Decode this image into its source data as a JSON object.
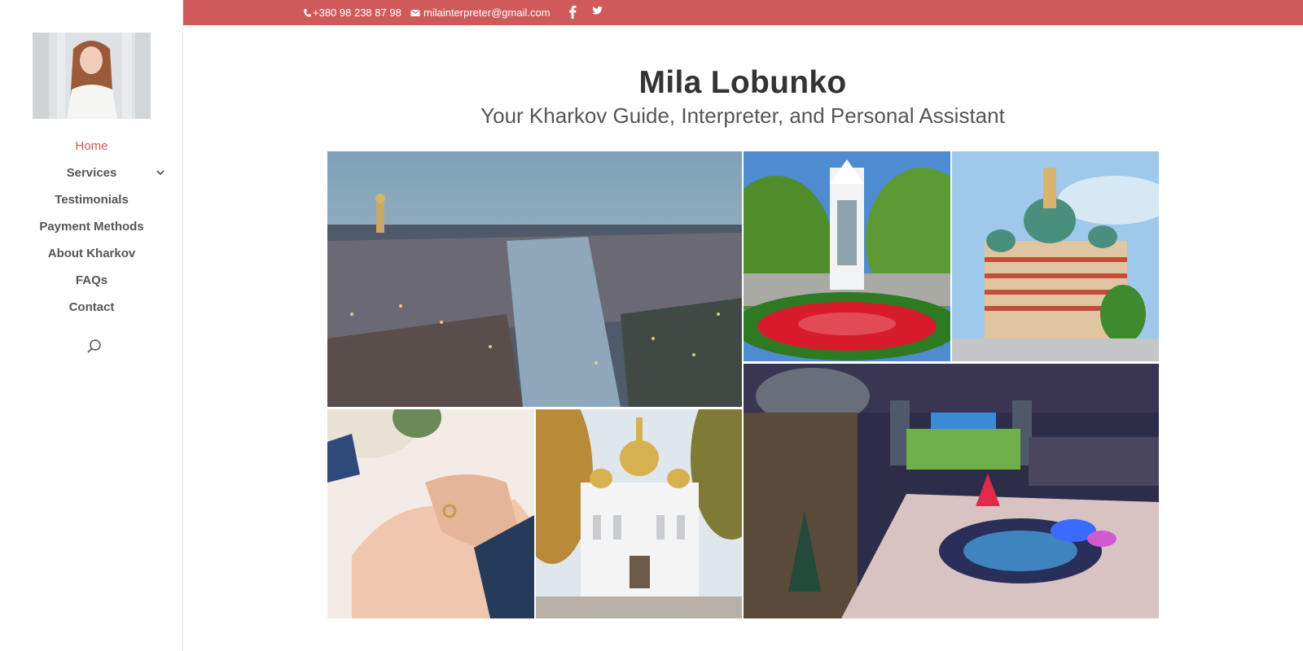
{
  "topbar": {
    "phone": "+380 98 238 87 98",
    "email": "milainterpreter@gmail.com",
    "social_icons": [
      "facebook-icon",
      "twitter-icon"
    ],
    "background": "#cf5a5c"
  },
  "sidebar": {
    "logo_alt": "avatar",
    "items": [
      {
        "label": "Home",
        "active": true
      },
      {
        "label": "Services",
        "has_submenu": true
      },
      {
        "label": "Testimonials"
      },
      {
        "label": "Payment Methods"
      },
      {
        "label": "About Kharkov"
      },
      {
        "label": "FAQs"
      },
      {
        "label": "Contact"
      }
    ],
    "search_icon": "search-icon"
  },
  "header": {
    "title": "Mila Lobunko",
    "subtitle": "Your Kharkov Guide, Interpreter, and Personal Assistant"
  },
  "gallery": {
    "images": [
      "kharkov-city-dusk-river",
      "mirror-stream-fountain",
      "annunciation-cathedral",
      "wedding-rings-hands",
      "white-church-gold-domes",
      "railway-station-night"
    ]
  },
  "colors": {
    "accent": "#d05555",
    "nav_text": "#555555",
    "title_text": "#333333"
  }
}
